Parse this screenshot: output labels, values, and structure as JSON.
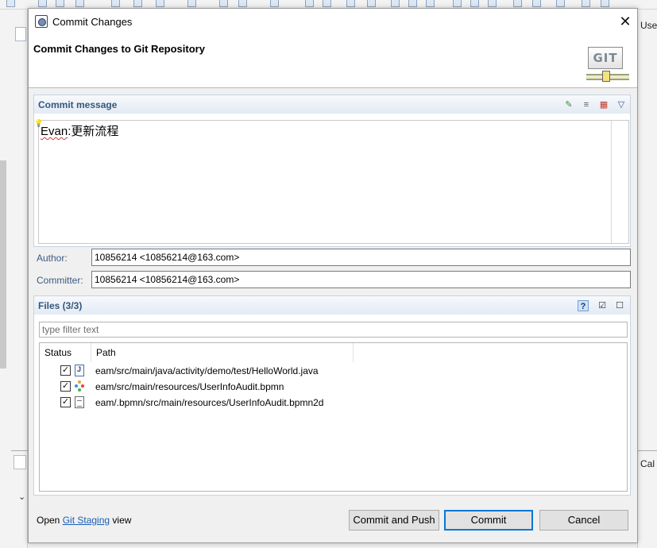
{
  "dialog": {
    "title": "Commit Changes",
    "header_title": "Commit Changes to Git Repository",
    "logo_text": "GIT"
  },
  "background": {
    "right_top_text": "Use",
    "right_bottom_text": "Cal"
  },
  "commit_message": {
    "section_label": "Commit message",
    "text_prefix": "Evan",
    "text_rest": ":更新流程",
    "icons": [
      "add-signed-off-icon",
      "amend-icon",
      "compute-changeid-icon",
      "menu-dropdown-icon"
    ]
  },
  "author": {
    "label": "Author:",
    "value": "10856214 <10856214@163.com>"
  },
  "committer": {
    "label": "Committer:",
    "value": "10856214 <10856214@163.com>"
  },
  "files": {
    "section_label": "Files (3/3)",
    "filter_placeholder": "type filter text",
    "columns": [
      "Status",
      "Path"
    ],
    "rows": [
      {
        "checked": true,
        "icon": "java-file-icon",
        "path": "eam/src/main/java/activity/demo/test/HelloWorld.java"
      },
      {
        "checked": true,
        "icon": "bpmn-file-icon",
        "path": "eam/src/main/resources/UserInfoAudit.bpmn"
      },
      {
        "checked": true,
        "icon": "bpmn2d-file-icon",
        "path": "eam/.bpmn/src/main/resources/UserInfoAudit.bpmn2d"
      }
    ],
    "checkmark": "✓"
  },
  "footer": {
    "open_prefix": "Open",
    "staging_link": "Git Staging",
    "open_suffix": "view"
  },
  "buttons": {
    "commit_and_push": "Commit and Push",
    "commit": "Commit",
    "cancel": "Cancel"
  },
  "colors": {
    "section_label": "#34577f",
    "field_label": "#3b5b83",
    "link": "#1a5fb4",
    "primary_button_border": "#0078d7"
  }
}
